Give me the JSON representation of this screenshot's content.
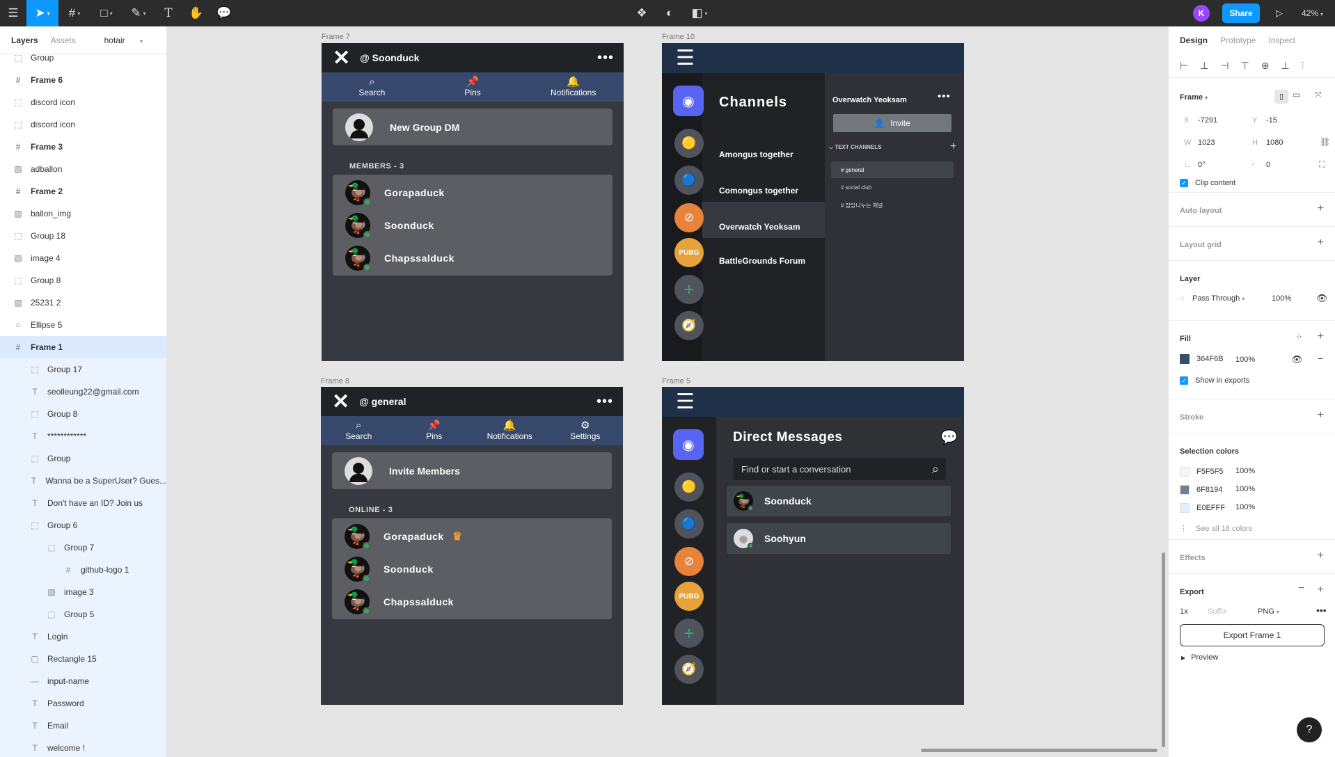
{
  "toolbar": {
    "share": "Share",
    "zoom": "42%",
    "avatar": "K"
  },
  "left_panel": {
    "tab_layers": "Layers",
    "tab_assets": "Assets",
    "page": "hotair",
    "layers": [
      {
        "icon": "⬚",
        "label": "Group",
        "bold": false,
        "depth": 0
      },
      {
        "icon": "#",
        "label": "Frame 6",
        "bold": true,
        "depth": 0
      },
      {
        "icon": "⬚",
        "label": "discord icon",
        "bold": false,
        "depth": 0
      },
      {
        "icon": "⬚",
        "label": "discord icon",
        "bold": false,
        "depth": 0
      },
      {
        "icon": "#",
        "label": "Frame 3",
        "bold": true,
        "depth": 0
      },
      {
        "icon": "▧",
        "label": "adballon",
        "bold": false,
        "depth": 0
      },
      {
        "icon": "#",
        "label": "Frame 2",
        "bold": true,
        "depth": 0
      },
      {
        "icon": "▧",
        "label": "ballon_img",
        "bold": false,
        "depth": 0
      },
      {
        "icon": "⬚",
        "label": "Group 18",
        "bold": false,
        "depth": 0
      },
      {
        "icon": "▧",
        "label": "image 4",
        "bold": false,
        "depth": 0
      },
      {
        "icon": "⬚",
        "label": "Group 8",
        "bold": false,
        "depth": 0
      },
      {
        "icon": "▧",
        "label": "25231 2",
        "bold": false,
        "depth": 0
      },
      {
        "icon": "○",
        "label": "Ellipse 5",
        "bold": false,
        "depth": 0
      },
      {
        "icon": "#",
        "label": "Frame 1",
        "bold": true,
        "depth": 0,
        "selected": true
      },
      {
        "icon": "⬚",
        "label": "Group 17",
        "bold": false,
        "depth": 1
      },
      {
        "icon": "T",
        "label": "seolleung22@gmail.com",
        "bold": false,
        "depth": 1
      },
      {
        "icon": "⬚",
        "label": "Group 8",
        "bold": false,
        "depth": 1
      },
      {
        "icon": "T",
        "label": "************",
        "bold": false,
        "depth": 1
      },
      {
        "icon": "⬚",
        "label": "Group",
        "bold": false,
        "depth": 1
      },
      {
        "icon": "T",
        "label": "Wanna be a SuperUser? Gues...",
        "bold": false,
        "depth": 1
      },
      {
        "icon": "T",
        "label": "Don't have an ID? Join us",
        "bold": false,
        "depth": 1
      },
      {
        "icon": "⬚",
        "label": "Group 6",
        "bold": false,
        "depth": 1
      },
      {
        "icon": "⬚",
        "label": "Group 7",
        "bold": false,
        "depth": 2
      },
      {
        "icon": "#",
        "label": "github-logo 1",
        "bold": false,
        "depth": 3
      },
      {
        "icon": "▧",
        "label": "image 3",
        "bold": false,
        "depth": 2
      },
      {
        "icon": "⬚",
        "label": "Group 5",
        "bold": false,
        "depth": 2
      },
      {
        "icon": "T",
        "label": "Login",
        "bold": false,
        "depth": 1
      },
      {
        "icon": "▢",
        "label": "Rectangle 15",
        "bold": false,
        "depth": 1
      },
      {
        "icon": "—",
        "label": "input-name",
        "bold": false,
        "depth": 1
      },
      {
        "icon": "T",
        "label": "Password",
        "bold": false,
        "depth": 1
      },
      {
        "icon": "T",
        "label": "Email",
        "bold": false,
        "depth": 1
      },
      {
        "icon": "T",
        "label": "welcome !",
        "bold": false,
        "depth": 1
      }
    ]
  },
  "frames": {
    "f7": {
      "label": "Frame 7",
      "title": "@ Soonduck",
      "tab_search": "Search",
      "tab_pins": "Pins",
      "tab_notif": "Notifications",
      "action": "New Group DM",
      "section": "MEMBERS - 3",
      "members": [
        "Gorapaduck",
        "Soonduck",
        "Chapssalduck"
      ]
    },
    "f10": {
      "label": "Frame 10",
      "channels_title": "Channels",
      "channels": [
        "Amongus together",
        "Comongus together",
        "Overwatch Yeoksam",
        "BattleGrounds Forum"
      ],
      "server_name": "Overwatch Yeoksam",
      "invite": "Invite",
      "text_channels": "TEXT CHANNELS",
      "text_list": [
        "# general",
        "# social club",
        "# 잡담나누는 채널"
      ]
    },
    "f8": {
      "label": "Frame 8",
      "title": "@ general",
      "tab_search": "Search",
      "tab_pins": "Pins",
      "tab_notif": "Notifications",
      "tab_settings": "Settings",
      "action": "Invite Members",
      "section": "ONLINE - 3",
      "members": [
        "Gorapaduck",
        "Soonduck",
        "Chapssalduck"
      ]
    },
    "f5": {
      "label": "Frame 5",
      "title": "Direct Messages",
      "search_placeholder": "Find or start a conversation",
      "dms": [
        "Soonduck",
        "Soohyun"
      ]
    }
  },
  "right_panel": {
    "tab_design": "Design",
    "tab_prototype": "Prototype",
    "tab_inspect": "Inspect",
    "frame_label": "Frame",
    "x_label": "X",
    "x_value": "-7291",
    "y_label": "Y",
    "y_value": "-15",
    "w_label": "W",
    "w_value": "1023",
    "h_label": "H",
    "h_value": "1080",
    "rotation": "0°",
    "radius": "0",
    "clip": "Clip content",
    "auto_layout": "Auto layout",
    "layout_grid": "Layout grid",
    "layer": "Layer",
    "blend": "Pass Through",
    "opacity": "100%",
    "fill": "Fill",
    "fill_hex": "364F6B",
    "fill_opacity": "100%",
    "show_exports": "Show in exports",
    "stroke": "Stroke",
    "selection_colors": "Selection colors",
    "colors": [
      {
        "hex": "F5F5F5",
        "opacity": "100%",
        "color": "#F5F5F5"
      },
      {
        "hex": "6F8194",
        "opacity": "100%",
        "color": "#6F8194"
      },
      {
        "hex": "E0EFFF",
        "opacity": "100%",
        "color": "#E0EFFF"
      }
    ],
    "see_all": "See all 18 colors",
    "effects": "Effects",
    "export": "Export",
    "scale": "1x",
    "suffix": "Suffix",
    "format": "PNG",
    "export_button": "Export Frame 1",
    "preview": "Preview"
  },
  "colors": {
    "accent": "#0d99ff",
    "frame_fill": "#364F6B",
    "discord_dark": "#36393f",
    "discord_darker": "#202225",
    "card": "#5c5e63",
    "online": "#3ba55d"
  }
}
